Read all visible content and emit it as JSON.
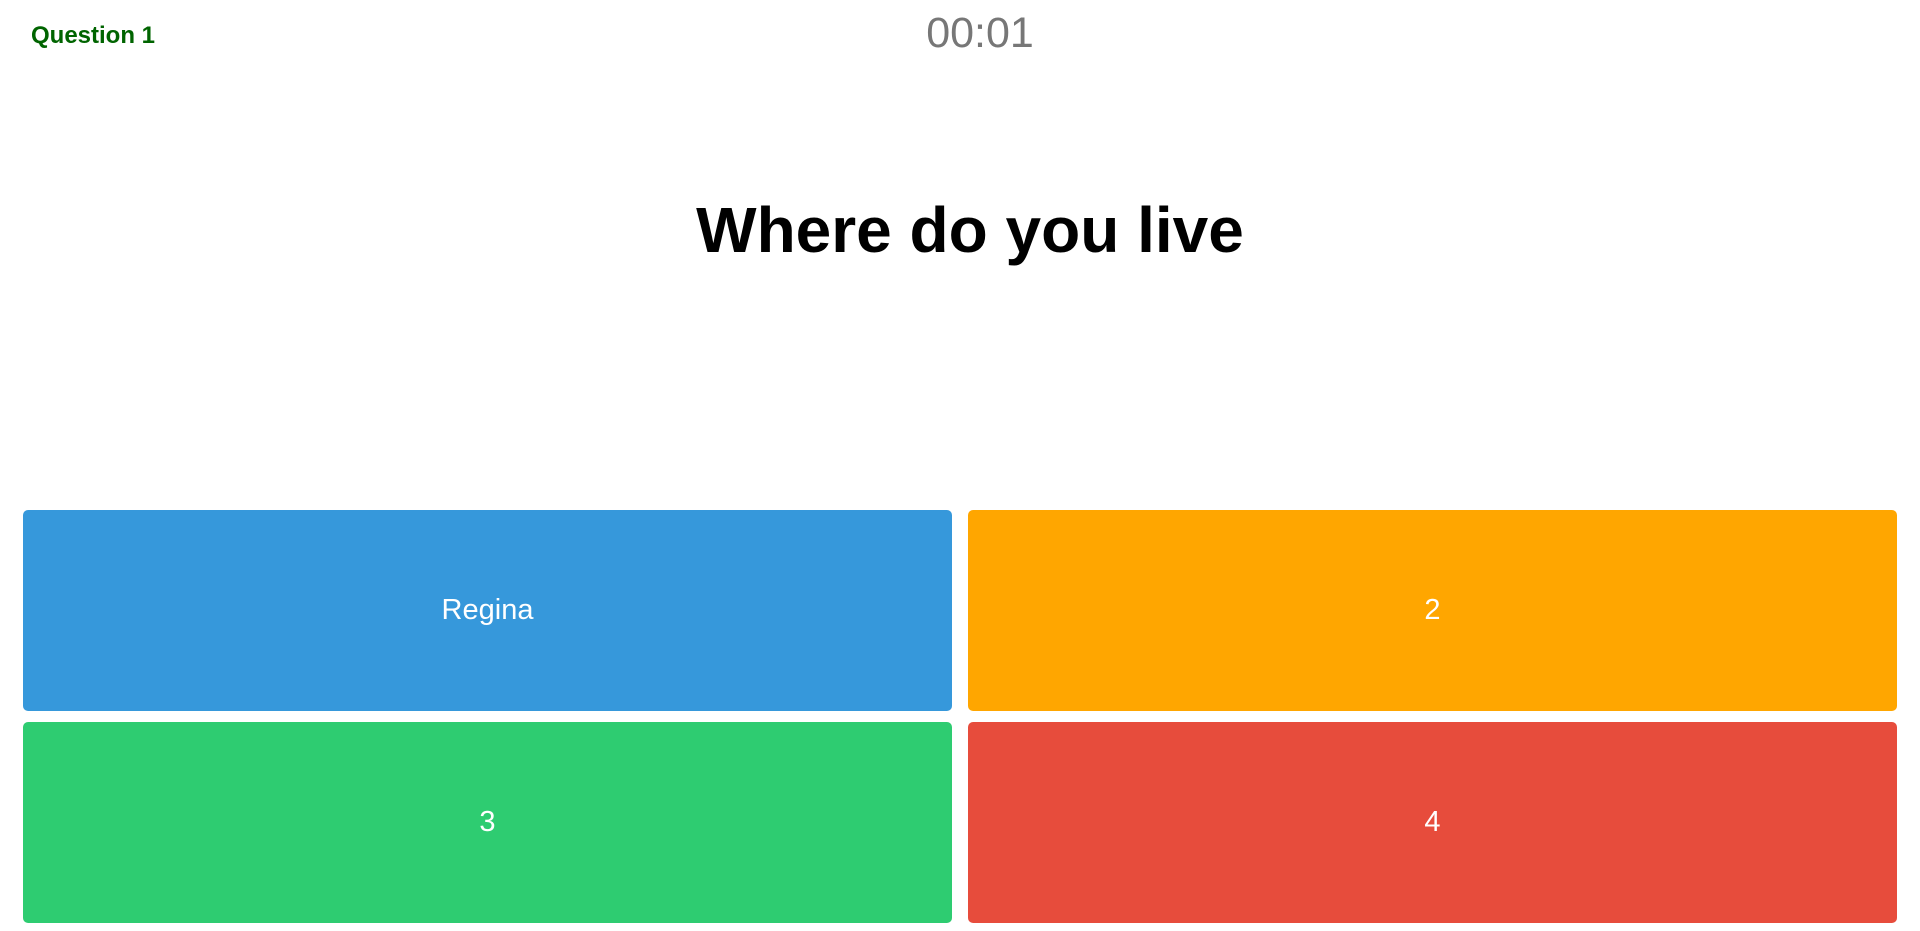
{
  "header": {
    "question_label": "Question 1",
    "timer": "00:01"
  },
  "question": {
    "text": "Where do you live"
  },
  "answers": [
    {
      "label": "Regina",
      "color": "#3698DB"
    },
    {
      "label": "2",
      "color": "#FFA600"
    },
    {
      "label": "3",
      "color": "#2ECC71"
    },
    {
      "label": "4",
      "color": "#E74C3C"
    }
  ]
}
